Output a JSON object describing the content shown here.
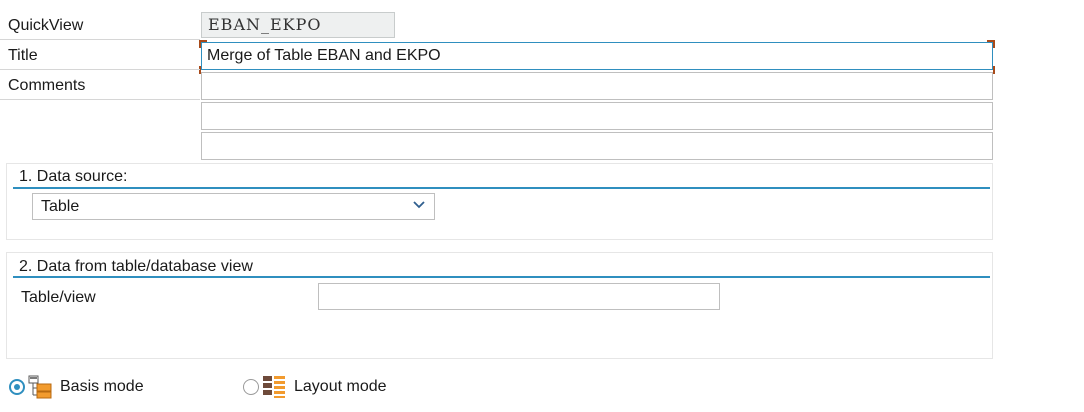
{
  "header": {
    "quickview_label": "QuickView",
    "quickview_value": "EBAN_EKPO",
    "title_label": "Title",
    "title_value": "Merge of Table EBAN and EKPO",
    "comments_label": "Comments",
    "comments": [
      "",
      "",
      ""
    ]
  },
  "data_source": {
    "group_title": "1. Data source:",
    "selected": "Table"
  },
  "table_view": {
    "group_title": "2. Data from table/database view",
    "field_label": "Table/view",
    "field_value": ""
  },
  "modes": {
    "basis_label": "Basis mode",
    "layout_label": "Layout mode",
    "selected": "Basis mode",
    "basis_icon": "basis-mode-icon",
    "layout_icon": "layout-mode-icon"
  },
  "colors": {
    "accent": "#2f8fbf",
    "focus_corner": "#a84a1a",
    "readonly_bg": "#eef0f0"
  }
}
